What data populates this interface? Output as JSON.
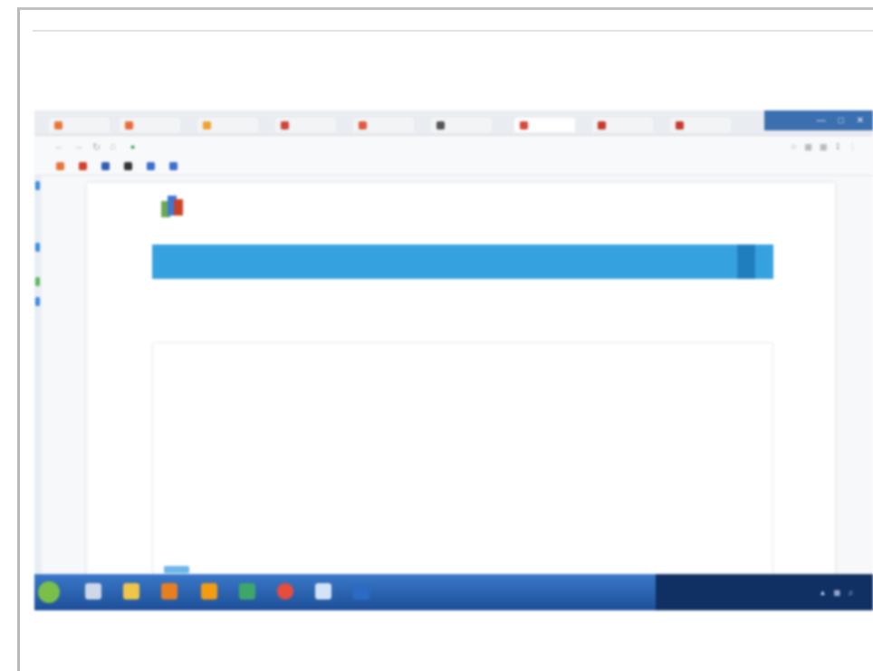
{
  "browser": {
    "tabs": [
      {
        "label": "",
        "favicon_color": "#e8743b"
      },
      {
        "label": "",
        "favicon_color": "#e86a3b"
      },
      {
        "label": "",
        "favicon_color": "#f0a030"
      },
      {
        "label": "",
        "favicon_color": "#d0433a"
      },
      {
        "label": "",
        "favicon_color": "#e2583e"
      },
      {
        "label": "",
        "favicon_color": "#555555"
      },
      {
        "label": "",
        "favicon_color": "#d9473b"
      },
      {
        "label": "",
        "favicon_color": "#c7382e"
      },
      {
        "label": "",
        "favicon_color": "#c7382e"
      }
    ],
    "url": "",
    "bookmarks": [
      {
        "label": "",
        "icon_color": "#e8743b"
      },
      {
        "label": "",
        "icon_color": "#d04030"
      },
      {
        "label": "",
        "icon_color": "#2f5fb3"
      },
      {
        "label": "",
        "icon_color": "#333333"
      },
      {
        "label": "",
        "icon_color": "#3b6fd0"
      },
      {
        "label": "",
        "icon_color": "#3b6fd0"
      }
    ]
  },
  "site": {
    "title": "",
    "subtitle": ""
  },
  "nav": {
    "home": "",
    "items": [
      {
        "label": ""
      },
      {
        "label": ""
      },
      {
        "label": "",
        "active": true
      },
      {
        "label": ""
      }
    ]
  },
  "page": {
    "heading": ""
  },
  "panel": {
    "lines": [
      "",
      "",
      "",
      "",
      "",
      "",
      "",
      "",
      "",
      "",
      ""
    ]
  },
  "colors": {
    "navbar": "#35a2df",
    "navbar_active": "#1f7fbe",
    "heading": "#3f8fd2",
    "taskbar": "#1d4f97"
  },
  "taskbar": {
    "clock": ""
  }
}
